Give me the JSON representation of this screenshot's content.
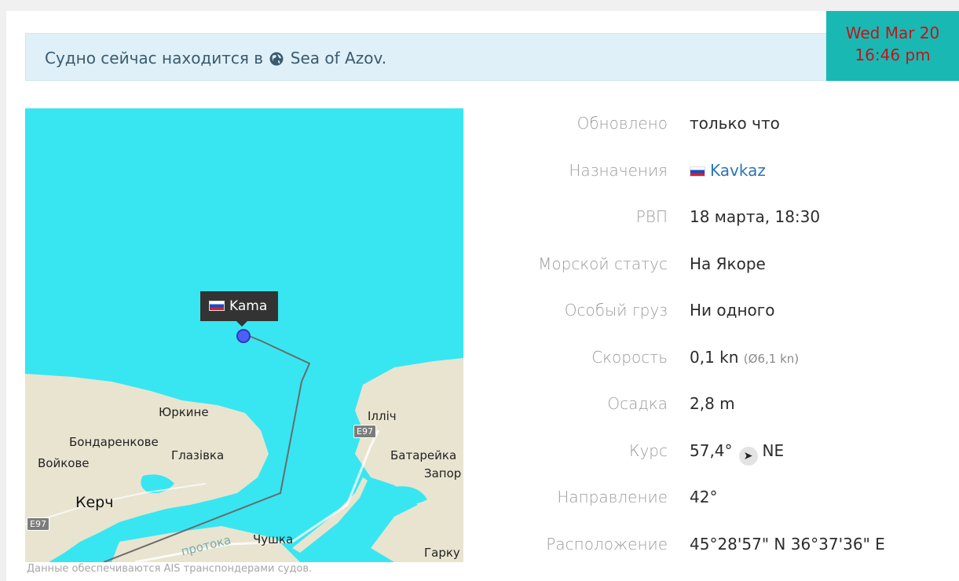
{
  "alert": {
    "prefix": "Судно сейчас находится в",
    "icon": "globe-icon",
    "location": "Sea of Azov."
  },
  "datetime": {
    "day": "Wed Mar 20",
    "time": "16:46 pm"
  },
  "map": {
    "vessel_name": "Kama",
    "vessel_flag": "russia-flag-icon",
    "places": {
      "yurkyne": "Юркине",
      "bondarenkove": "Бондаренкове",
      "glazivka": "Глазівка",
      "voykove": "Войкове",
      "kerch": "Керч",
      "chushka": "Чушка",
      "ilich": "Ілліч",
      "batareika": "Батарейка",
      "zapor": "Запор",
      "garku": "Гарку",
      "channel": "протока"
    },
    "road_badges": [
      "E97",
      "E97"
    ],
    "colors": {
      "sea": "#37e6f1",
      "land": "#e8e4d0",
      "track": "#6b6b6b"
    }
  },
  "caption": "Данные обеспечиваются AIS транспондерами судов.",
  "details": [
    {
      "label": "Обновлено",
      "value": "только что"
    },
    {
      "label": "Назначения",
      "value": "Kavkaz",
      "flag": "russia-flag-icon"
    },
    {
      "label": "РВП",
      "value": "18 марта, 18:30"
    },
    {
      "label": "Морской статус",
      "value": "На Якоре"
    },
    {
      "label": "Особый груз",
      "value": "Ни одного"
    },
    {
      "label": "Скорость",
      "value": "0,1 kn",
      "extra": "(Ø6,1 kn)"
    },
    {
      "label": "Осадка",
      "value": "2,8 m"
    },
    {
      "label": "Курс",
      "value": "57,4°",
      "direction": "NE",
      "icon": "navigation-arrow-icon"
    },
    {
      "label": "Направление",
      "value": "42°"
    },
    {
      "label": "Расположение",
      "value": "45°28'57\" N 36°37'36\" E"
    }
  ]
}
